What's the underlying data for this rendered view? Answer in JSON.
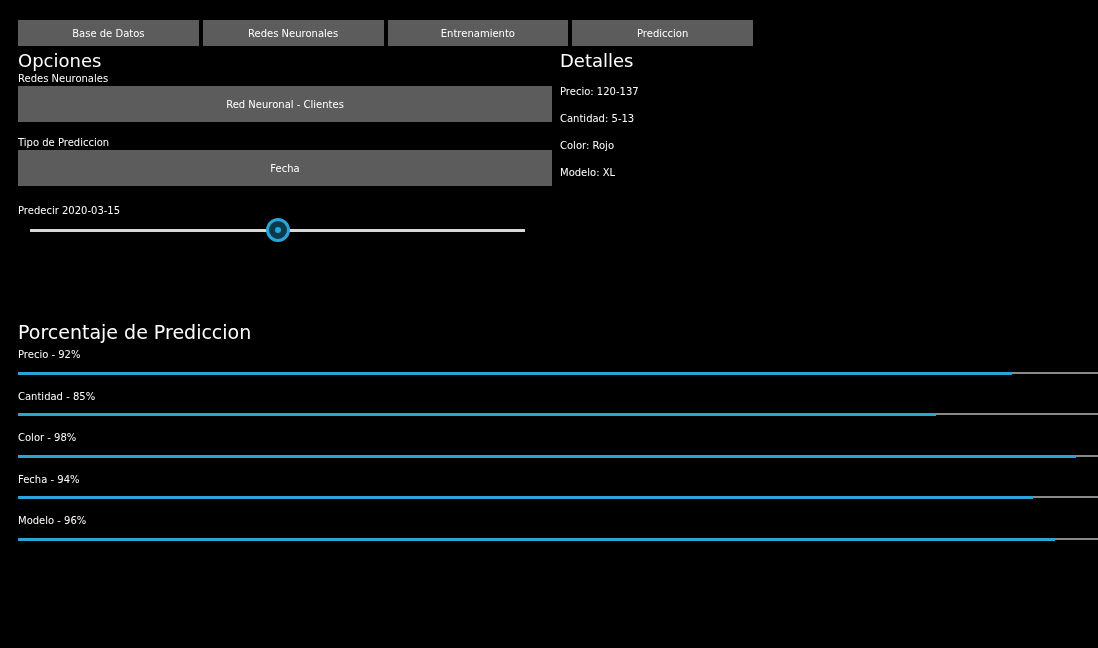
{
  "tabs": [
    "Base de Datos",
    "Redes Neuronales",
    "Entrenamiento",
    "Prediccion"
  ],
  "options": {
    "title": "Opciones",
    "network_label": "Redes Neuronales",
    "network_value": "Red Neuronal - Clientes",
    "type_label": "Tipo de Prediccion",
    "type_value": "Fecha",
    "slider_label": "Predecir 2020-03-15",
    "slider": {
      "level": 0.5
    }
  },
  "details": {
    "title": "Detalles",
    "items": [
      "Precio: 120-137",
      "Cantidad: 5-13",
      "Color: Rojo",
      "Modelo: XL"
    ]
  },
  "prediction": {
    "title": "Porcentaje de Prediccion",
    "bars": [
      {
        "label": "Precio - 92%",
        "level": 0.92
      },
      {
        "label": "Cantidad - 85%",
        "level": 0.85
      },
      {
        "label": "Color - 98%",
        "level": 0.98
      },
      {
        "label": "Fecha - 94%",
        "level": 0.94
      },
      {
        "label": "Modelo - 96%",
        "level": 0.96
      }
    ]
  }
}
